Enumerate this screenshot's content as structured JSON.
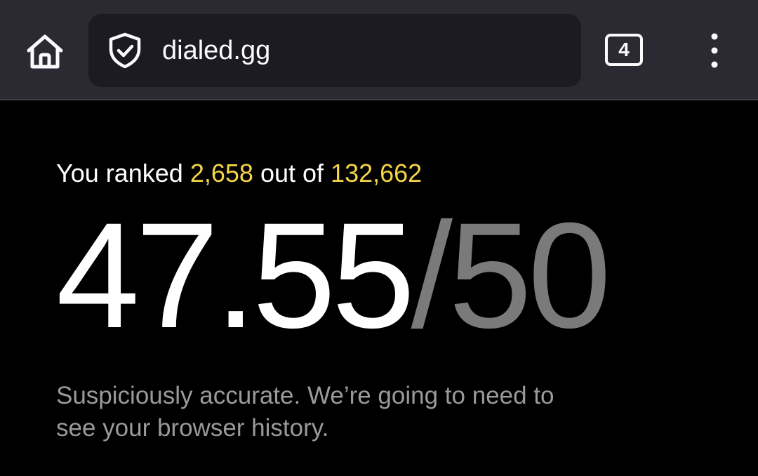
{
  "browser": {
    "url": "dialed.gg",
    "tab_count": "4",
    "icons": {
      "home": "home-icon",
      "shield": "shield-check-icon",
      "tabs": "tab-counter-icon",
      "menu": "more-vertical-icon"
    }
  },
  "result": {
    "rank_prefix": "You ranked",
    "rank": "2,658",
    "rank_middle": "out of",
    "total": "132,662",
    "score": "47.55",
    "slash": "/",
    "max_score": "50",
    "message": "Suspiciously accurate. We’re going to need to see your browser history."
  },
  "colors": {
    "toolbar_bg": "#2b2a33",
    "urlbar_bg": "#1c1b22",
    "page_bg": "#000000",
    "highlight": "#f5d547",
    "muted": "#7a7a7a"
  }
}
